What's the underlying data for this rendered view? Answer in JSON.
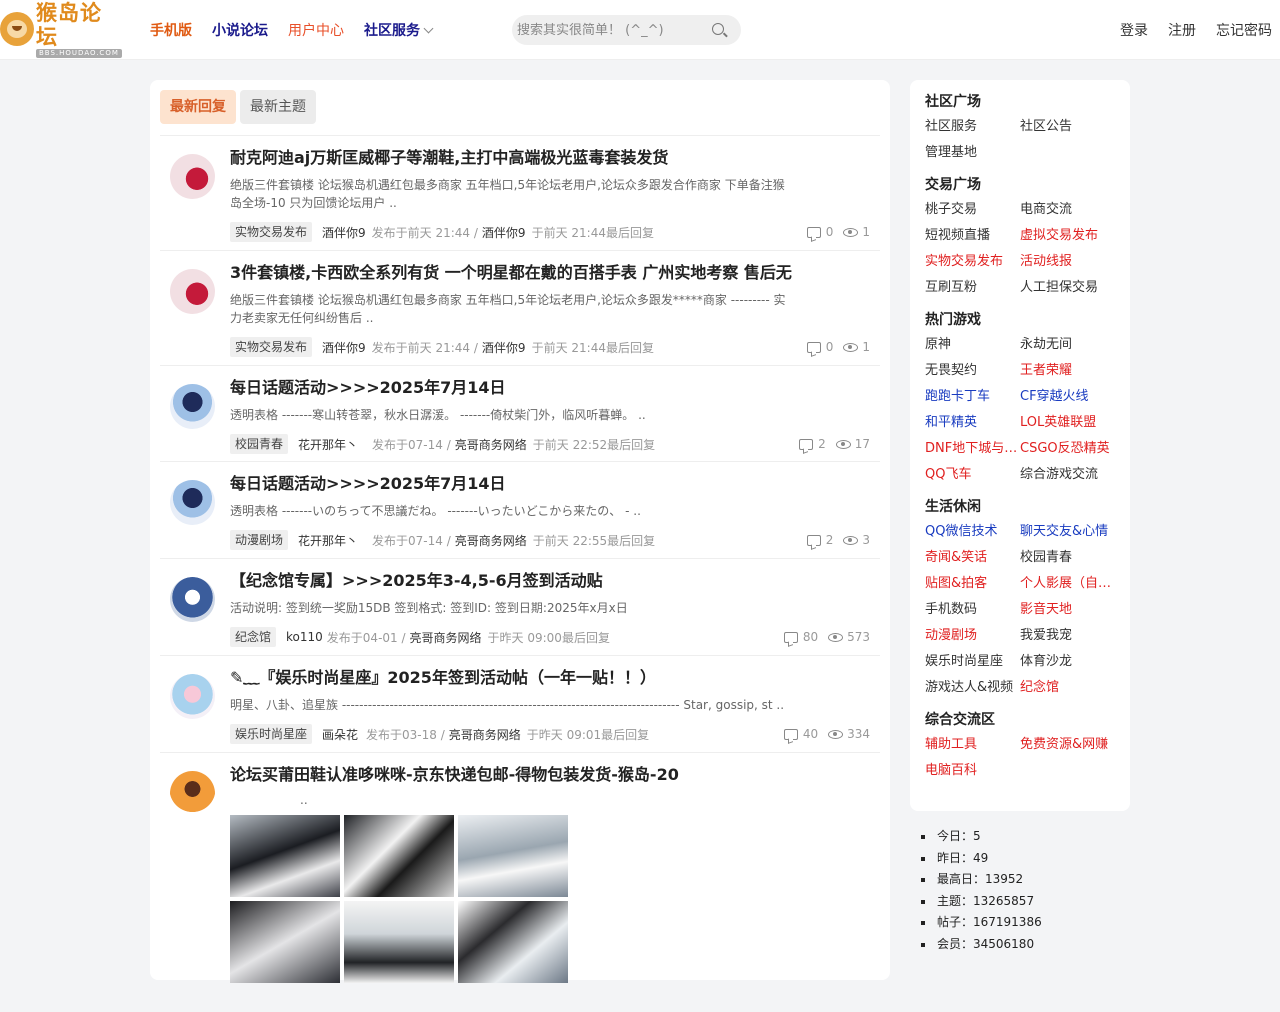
{
  "header": {
    "logo_cn": "猴岛论坛",
    "logo_en": "BBS.HOUDAO.COM",
    "nav": [
      {
        "label": "手机版"
      },
      {
        "label": "小说论坛"
      },
      {
        "label": "用户中心"
      },
      {
        "label": "社区服务"
      }
    ],
    "search_placeholder": "搜索其实很简单！ (^_^)",
    "auth": [
      "登录",
      "注册",
      "忘记密码"
    ]
  },
  "tabs": [
    "最新回复",
    "最新主题"
  ],
  "threads": [
    {
      "title": "耐克阿迪aj万斯匡威椰子等潮鞋,主打中高端极光蓝毒套装发货",
      "summary": "绝版三件套镇楼 论坛猴岛机遇红包最多商家 五年档口,5年论坛老用户,论坛众多跟发合作商家 下单备注猴岛全场-10 只为回馈论坛用户 ..",
      "category": "实物交易发布",
      "author": "酒伴你9",
      "posted": "发布于前天 21:44 /",
      "last_user": "酒伴你9",
      "last_time": "于前天 21:44最后回复",
      "replies": "0",
      "views": "1"
    },
    {
      "title": "3件套镇楼,卡西欧全系列有货 一个明星都在戴的百搭手表 广州实地考察 售后无",
      "summary": "绝版三件套镇楼 论坛猴岛机遇红包最多商家 五年档口,5年论坛老用户,论坛众多跟发*****商家 --------- 实力老卖家无任何纠纷售后 ..",
      "category": "实物交易发布",
      "author": "酒伴你9",
      "posted": "发布于前天 21:44 /",
      "last_user": "酒伴你9",
      "last_time": "于前天 21:44最后回复",
      "replies": "0",
      "views": "1"
    },
    {
      "title": "每日话题活动>>>>2025年7月14日",
      "summary": "透明表格 -------寒山转苍翠，秋水日潺湲。 -------倚杖柴门外，临风听暮蝉。 ..",
      "category": "校园青春",
      "author": "花开那年丶",
      "posted": "发布于07-14 /",
      "last_user": "亮哥商务网络",
      "last_time": "于前天 22:52最后回复",
      "replies": "2",
      "views": "17"
    },
    {
      "title": "每日话题活动>>>>2025年7月14日",
      "summary": "透明表格 -------いのちって不思議だね。 -------いったいどこから来たの、 - ..",
      "category": "动漫剧场",
      "author": "花开那年丶",
      "posted": "发布于07-14 /",
      "last_user": "亮哥商务网络",
      "last_time": "于前天 22:55最后回复",
      "replies": "2",
      "views": "3"
    },
    {
      "title": "【纪念馆专属】>>>2025年3-4,5-6月签到活动贴",
      "summary": "活动说明: 签到统一奖励15DB 签到格式: 签到ID: 签到日期:2025年x月x日",
      "category": "纪念馆",
      "author": "ko110",
      "posted": "发布于04-01 /",
      "last_user": "亮哥商务网络",
      "last_time": "于昨天 09:00最后回复",
      "replies": "80",
      "views": "573"
    },
    {
      "title": "✎﹏『娱乐时尚星座』2025年签到活动帖（一年一贴！！）",
      "summary": "明星、八卦、追星族 ------------------------------------------------------------------------------ Star, gossip, st ..",
      "category": "娱乐时尚星座",
      "author": "画朵花",
      "posted": "发布于03-18 /",
      "last_user": "亮哥商务网络",
      "last_time": "于昨天 09:01最后回复",
      "replies": "40",
      "views": "334"
    },
    {
      "title": "论坛买莆田鞋认准哆咪咪-京东快递包邮-得物包装发货-猴岛-20",
      "summary": "..",
      "category": "",
      "author": "",
      "posted": "",
      "last_user": "",
      "last_time": "",
      "replies": "",
      "views": ""
    }
  ],
  "sidebar": [
    {
      "heading": "社区广场",
      "links": [
        "社区服务",
        "社区公告",
        "管理基地"
      ]
    },
    {
      "heading": "交易广场",
      "links": [
        "桃子交易",
        "电商交流",
        "短视频直播",
        "虚拟交易发布",
        "实物交易发布",
        "活动线报",
        "互刷互粉",
        "人工担保交易"
      ]
    },
    {
      "heading": "热门游戏",
      "links": [
        "原神",
        "永劫无间",
        "无畏契约",
        "王者荣耀",
        "跑跑卡丁车",
        "CF穿越火线",
        "和平精英",
        "LOL英雄联盟",
        "DNF地下城与勇士",
        "CSGO反恐精英",
        "QQ飞车",
        "综合游戏交流"
      ]
    },
    {
      "heading": "生活休闲",
      "links": [
        "QQ微信技术",
        "聊天交友&心情",
        "奇闻&笑话",
        "校园青春",
        "贴图&拍客",
        "个人影展（自拍）",
        "手机数码",
        "影音天地",
        "动漫剧场",
        "我爱我宠",
        "娱乐时尚星座",
        "体育沙龙",
        "游戏达人&视频",
        "纪念馆"
      ]
    },
    {
      "heading": "综合交流区",
      "links": [
        "辅助工具",
        "免费资源&网赚",
        "电脑百科"
      ]
    }
  ],
  "stats": [
    "今日：5",
    "昨日：49",
    "最高日：13952",
    "主题：13265857",
    "帖子：167191386",
    "会员：34506180"
  ],
  "colors": {
    "accent": "#e05a12",
    "nav_navy": "#1a1a8c",
    "link_red": "#e02020",
    "link_blue": "#1a3cc0",
    "tab_active_bg": "#fde3cf"
  }
}
